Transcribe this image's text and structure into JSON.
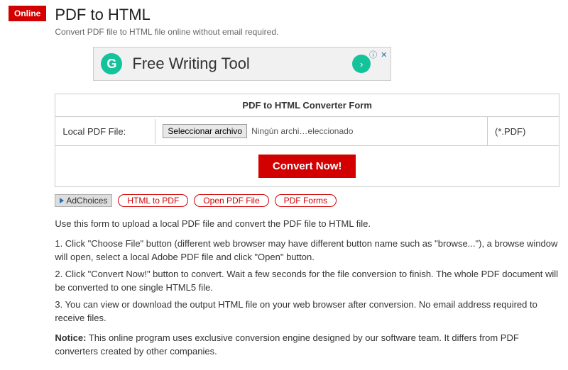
{
  "badge": "Online",
  "title": "PDF to HTML",
  "subtitle": "Convert PDF file to HTML file online without email required.",
  "ad": {
    "logo": "G",
    "text": "Free Writing Tool",
    "close": "ⓘ ✕"
  },
  "form": {
    "header": "PDF to HTML Converter Form",
    "label": "Local PDF File:",
    "button": "Seleccionar archivo",
    "filetext": "Ningún archi…eleccionado",
    "ext": "(*.PDF)",
    "convert": "Convert Now!"
  },
  "chips": {
    "adc": "AdChoices",
    "c1": "HTML to PDF",
    "c2": "Open PDF File",
    "c3": "PDF Forms"
  },
  "text": {
    "intro": "Use this form to upload a local PDF file and convert the PDF file to HTML file.",
    "s1": "1. Click \"Choose File\" button (different web browser may have different button name such as \"browse...\"), a browse window will open, select a local Adobe PDF file and click \"Open\" button.",
    "s2": "2. Click \"Convert Now!\" button to convert. Wait a few seconds for the file conversion to finish. The whole PDF document will be converted to one single HTML5 file.",
    "s3": "3. You can view or download the output HTML file on your web browser after conversion. No email address required to receive files.",
    "noticeLabel": "Notice:",
    "notice": " This online program uses exclusive conversion engine designed by our software team. It differs from PDF converters created by other companies."
  }
}
